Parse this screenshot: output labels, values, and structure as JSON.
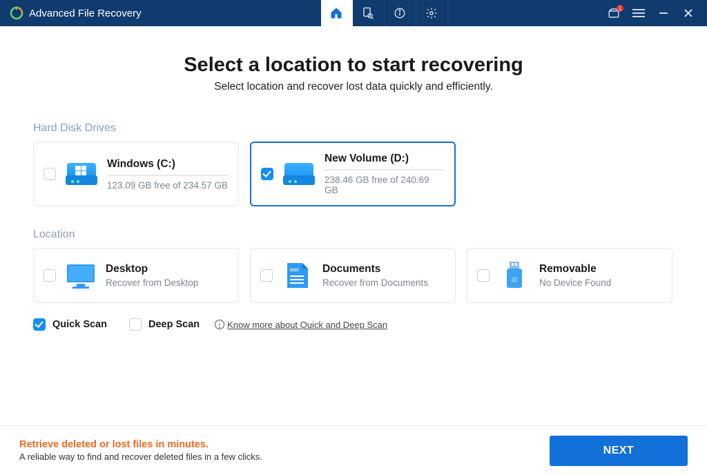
{
  "app": {
    "title": "Advanced File Recovery"
  },
  "titlebar": {
    "notif_count": "1"
  },
  "heading": {
    "title": "Select a location to start recovering",
    "subtitle": "Select location and recover lost data quickly and efficiently."
  },
  "sections": {
    "drives_label": "Hard Disk Drives",
    "location_label": "Location"
  },
  "drives": [
    {
      "title": "Windows (C:)",
      "sub": "123.09 GB free of 234.57 GB"
    },
    {
      "title": "New Volume (D:)",
      "sub": "238.46 GB free of 240.69 GB"
    }
  ],
  "locations": [
    {
      "title": "Desktop",
      "sub": "Recover from Desktop"
    },
    {
      "title": "Documents",
      "sub": "Recover from Documents"
    },
    {
      "title": "Removable",
      "sub": "No Device Found"
    }
  ],
  "scan": {
    "quick_label": "Quick Scan",
    "deep_label": "Deep Scan",
    "know_more": "Know more about Quick and Deep Scan"
  },
  "footer": {
    "title": "Retrieve deleted or lost files in minutes.",
    "sub": "A reliable way to find and recover deleted files in a few clicks.",
    "next": "NEXT"
  }
}
